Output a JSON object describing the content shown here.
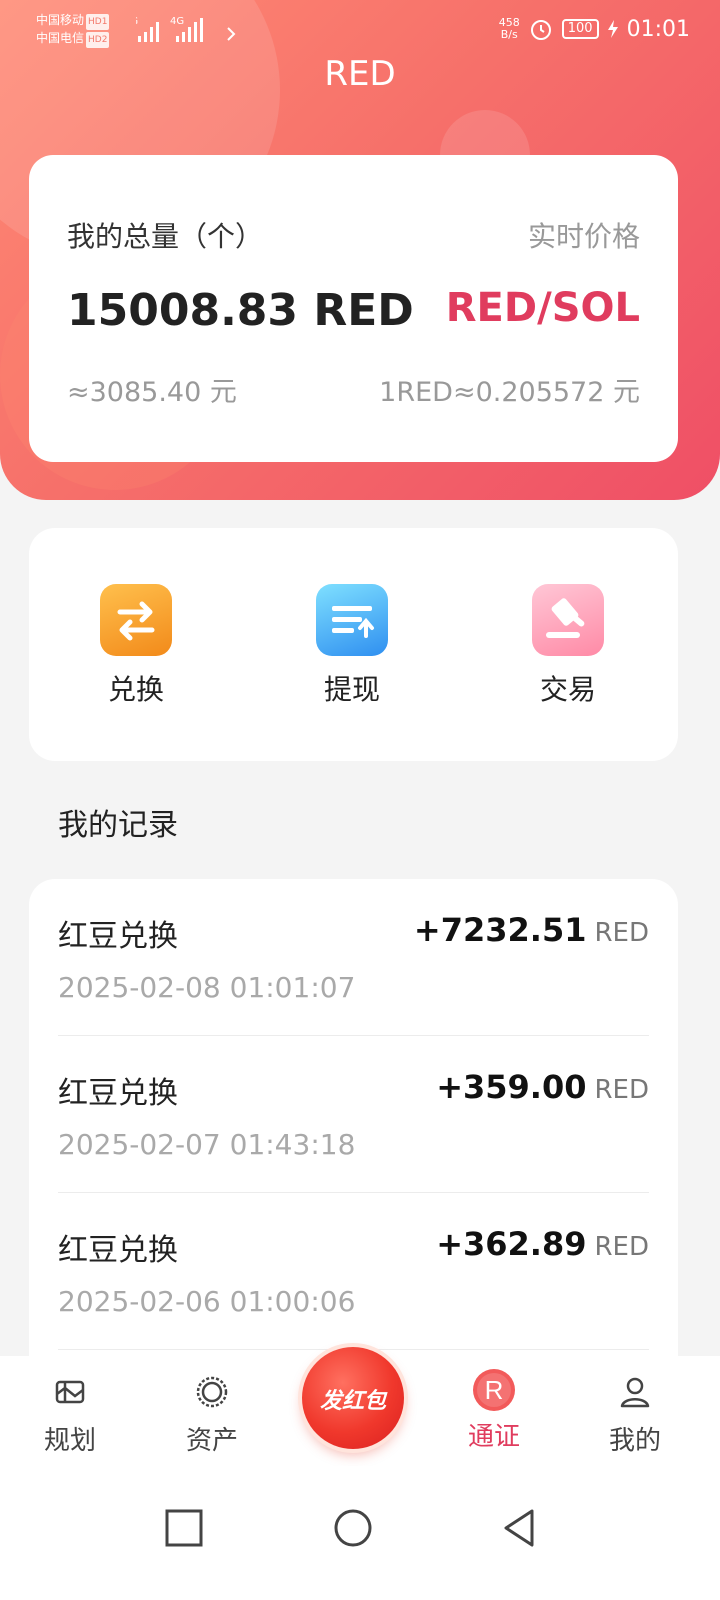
{
  "status_bar": {
    "carrier1": "中国移动",
    "carrier1_badge": "HD1",
    "carrier2": "中国电信",
    "carrier2_badge": "HD2",
    "network": "4G",
    "speed_value": "458",
    "speed_unit": "B/s",
    "battery": "100",
    "time": "01:01"
  },
  "header": {
    "title": "RED"
  },
  "summary": {
    "label": "我的总量（个）",
    "price_label": "实时价格",
    "amount": "15008.83 RED",
    "pair": "RED/SOL",
    "approx_value": "≈3085.40 元",
    "rate": "1RED≈0.205572 元"
  },
  "actions": [
    {
      "label": "兑换",
      "icon": "exchange-icon",
      "color": "#f7a233"
    },
    {
      "label": "提现",
      "icon": "withdraw-icon",
      "color": "#3aa8f5"
    },
    {
      "label": "交易",
      "icon": "gavel-icon",
      "color": "#ff8fa8"
    }
  ],
  "records": {
    "title": "我的记录",
    "items": [
      {
        "title": "红豆兑换",
        "amount": "+7232.51",
        "unit": "RED",
        "time": "2025-02-08 01:01:07"
      },
      {
        "title": "红豆兑换",
        "amount": "+359.00",
        "unit": "RED",
        "time": "2025-02-07 01:43:18"
      },
      {
        "title": "红豆兑换",
        "amount": "+362.89",
        "unit": "RED",
        "time": "2025-02-06 01:00:06"
      }
    ]
  },
  "tabbar": {
    "items": [
      {
        "label": "规划",
        "icon": "map-icon"
      },
      {
        "label": "资产",
        "icon": "asset-ring-icon"
      },
      {
        "label": "通证",
        "icon": "token-r-icon",
        "active": true
      },
      {
        "label": "我的",
        "icon": "user-icon"
      }
    ],
    "center_button": "发红包",
    "token_letter": "R",
    "accent": "#e03c5e"
  }
}
